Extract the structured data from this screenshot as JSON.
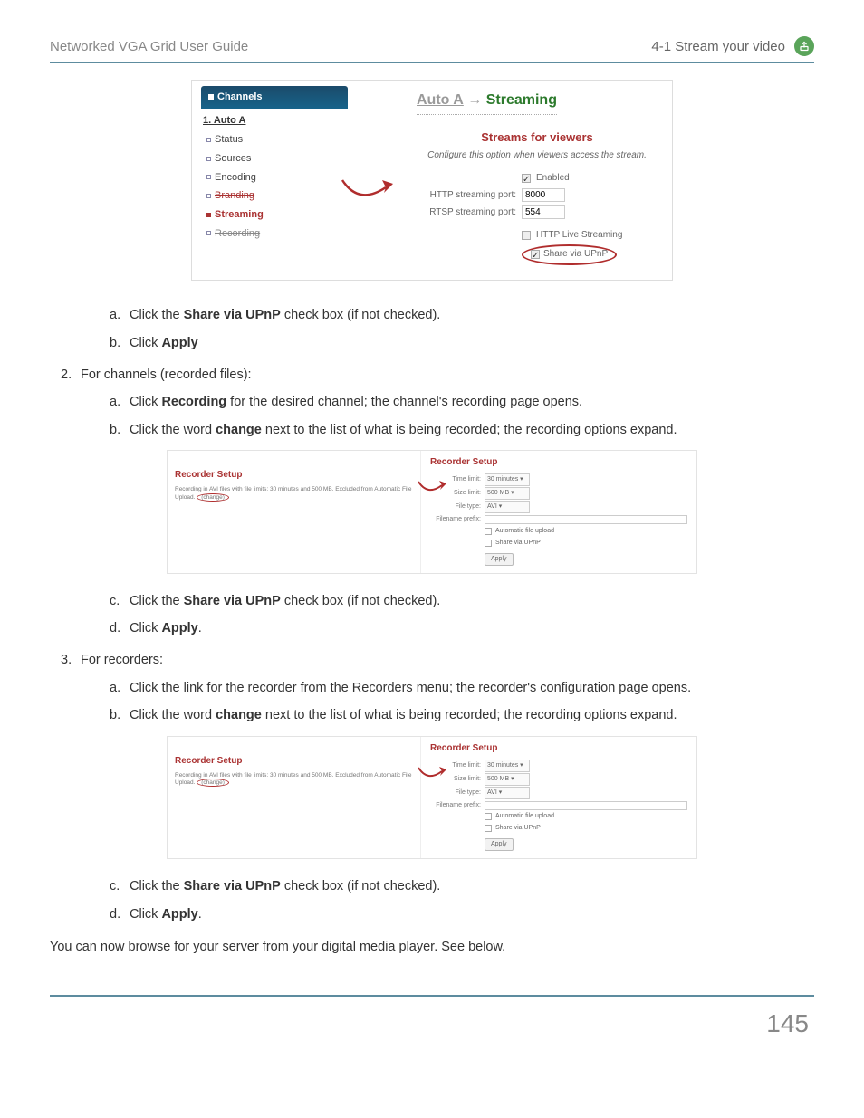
{
  "header": {
    "left": "Networked VGA Grid User Guide",
    "right": "4-1 Stream your video"
  },
  "fig1": {
    "channels_header": "Channels",
    "ch1": "1. Auto A",
    "items": {
      "status": "Status",
      "sources": "Sources",
      "encoding": "Encoding",
      "branding": "Branding",
      "streaming": "Streaming",
      "recording": "Recording"
    },
    "breadcrumb_a": "Auto A",
    "breadcrumb_arrow": " → ",
    "breadcrumb_b": "Streaming",
    "streams_title": "Streams for viewers",
    "streams_sub": "Configure this option when viewers access the stream.",
    "enabled": "Enabled",
    "http_label": "HTTP streaming port:",
    "http_value": "8000",
    "rtsp_label": "RTSP streaming port:",
    "rtsp_value": "554",
    "hls": "HTTP Live Streaming",
    "upnp": "Share via UPnP"
  },
  "steps": {
    "a1": "Click the ",
    "a1b": "Share via UPnP",
    "a1c": " check box (if not checked).",
    "b1": "Click ",
    "b1b": "Apply",
    "n2": "For channels (recorded files):",
    "n2a": "Click ",
    "n2ab": "Recording",
    "n2ac": " for the desired channel; the channel's recording page opens.",
    "n2b": "Click the word ",
    "n2bb": "change",
    "n2bc": " next to the list of what is being recorded; the recording options expand.",
    "n2c": "Click the ",
    "n2cb": "Share via UPnP",
    "n2cc": " check box (if not checked).",
    "n2d": "Click ",
    "n2db": "Apply",
    "n2dc": ".",
    "n3": "For recorders:",
    "n3a": "Click the link for the recorder from the Recorders menu; the recorder's configuration page opens.",
    "n3b": "Click the word ",
    "n3bb": "change",
    "n3bc": " next to the list of what is being recorded; the recording options expand.",
    "n3c": "Click the ",
    "n3cb": "Share via UPnP",
    "n3cc": " check box (if not checked).",
    "n3d": "Click ",
    "n3db": "Apply",
    "n3dc": "."
  },
  "rec": {
    "title": "Recorder Setup",
    "desc_pre": "Recording in AVI files with file limits: 30 minutes and 500 MB. Excluded from Automatic File Upload. ",
    "desc_change": "(change)",
    "time_label": "Time limit:",
    "time_val": "30 minutes ▾",
    "size_label": "Size limit:",
    "size_val": "500 MB ▾",
    "ftype_label": "File type:",
    "ftype_val": "AVI        ▾",
    "prefix_label": "Filename prefix:",
    "afu": "Automatic file upload",
    "share": "Share via UPnP",
    "apply": "Apply"
  },
  "closing": "You can now browse for your server from your digital media player. See below.",
  "page_number": "145"
}
